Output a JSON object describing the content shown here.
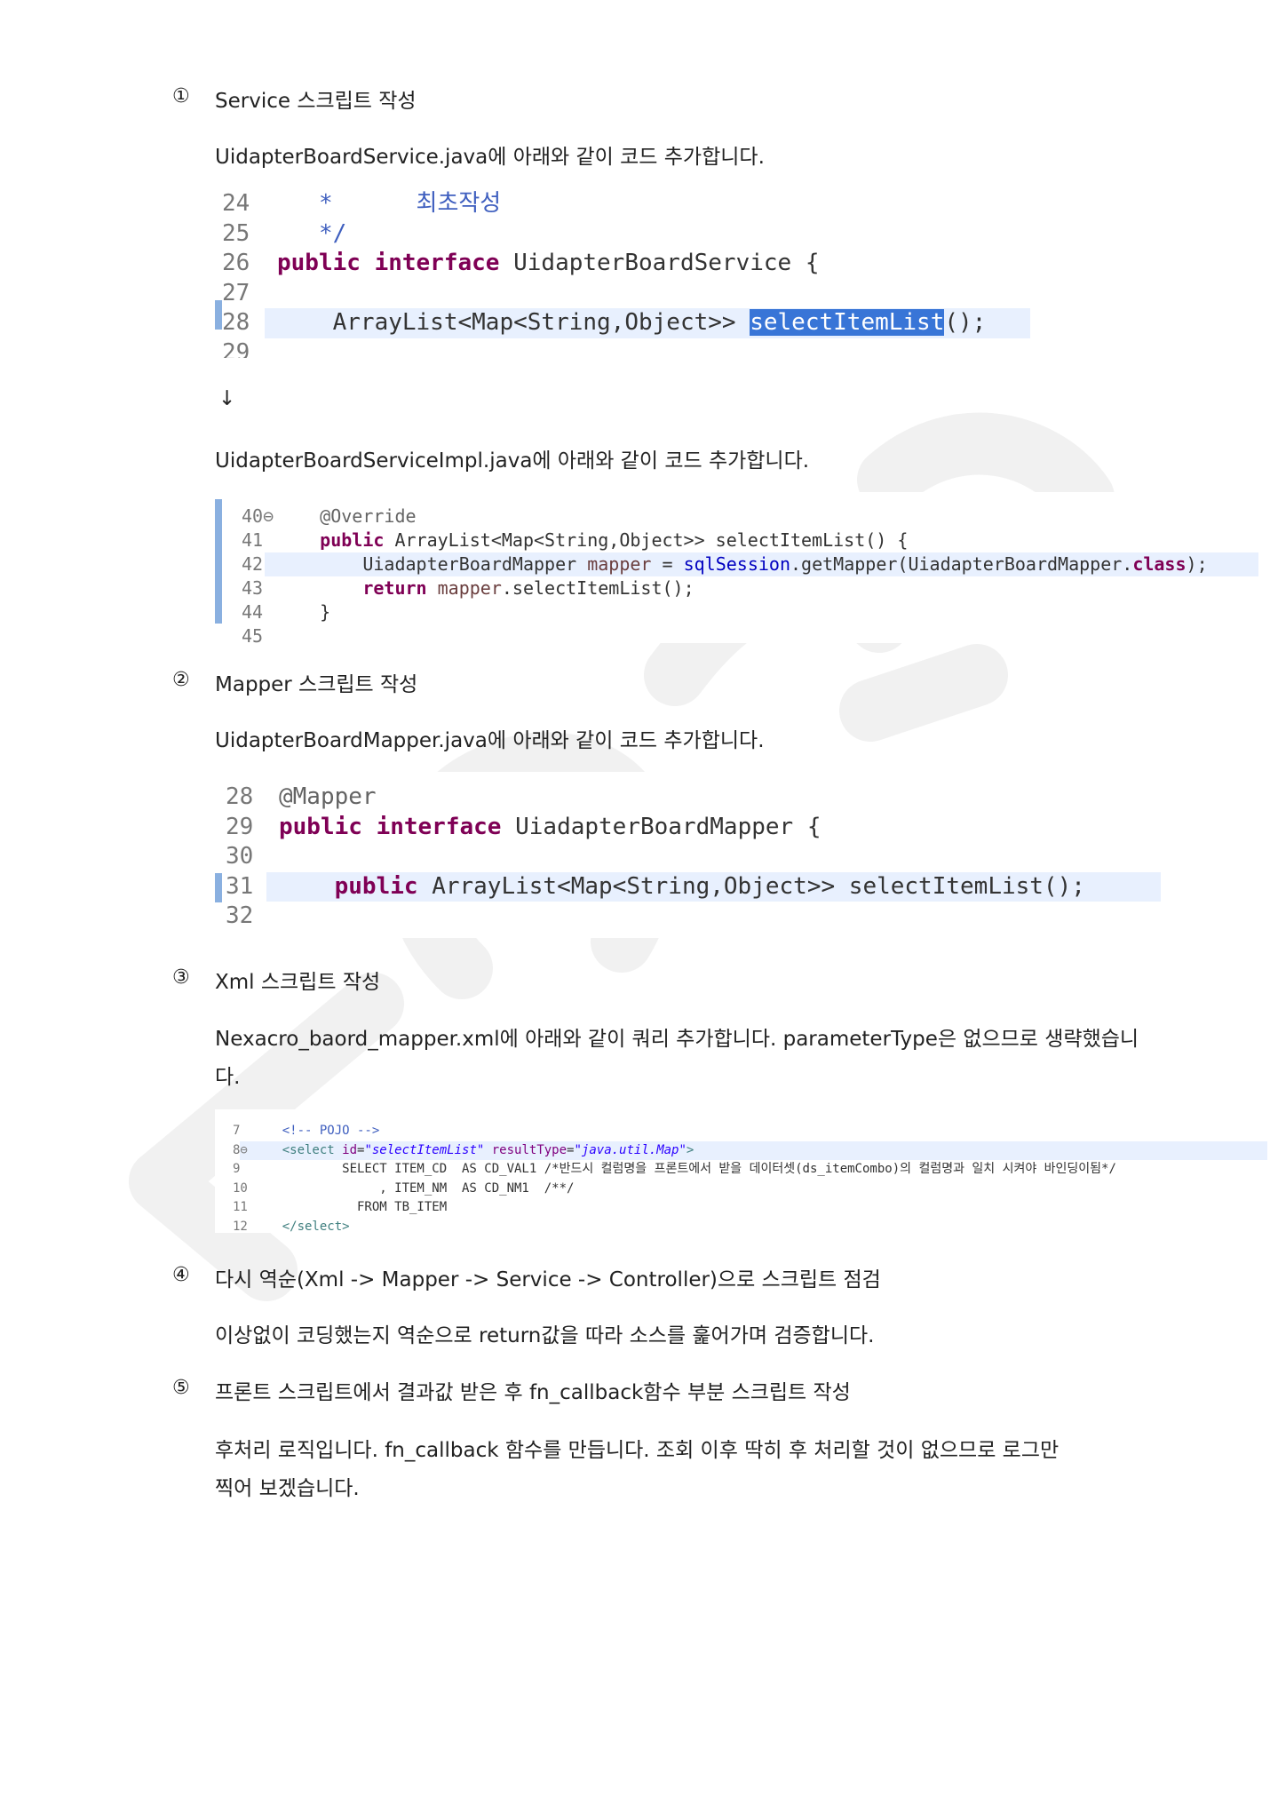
{
  "sections": [
    {
      "marker": "①",
      "heading": "Service  스크립트 작성"
    },
    {
      "marker": "②",
      "heading": "Mapper 스크립트 작성"
    },
    {
      "marker": "③",
      "heading": "Xml 스크립트 작성"
    },
    {
      "marker": "④",
      "heading": "다시 역순(Xml -> Mapper -> Service -> Controller)으로 스크립트 점검"
    },
    {
      "marker": "⑤",
      "heading": "프론트 스크립트에서 결과값 받은 후 fn_callback함수 부분 스크립트 작성"
    }
  ],
  "paragraphs": {
    "service_intro": "UidapterBoardService.java에 아래와 같이 코드 추가합니다.",
    "arrow": "↓",
    "impl_intro": "UidapterBoardServiceImpl.java에 아래와 같이 코드 추가합니다.",
    "mapper_intro": "UidapterBoardMapper.java에 아래와 같이 코드 추가합니다.",
    "xml_intro_1": "Nexacro_baord_mapper.xml에 아래와 같이 쿼리 추가합니다. parameterType은 없으므로 생략했습니",
    "xml_intro_2": "다.",
    "check": "이상없이 코딩했는지 역순으로 return값을 따라 소스를 훑어가며 검증합니다.",
    "callback_1": "후처리 로직입니다. fn_callback 함수를 만듭니다. 조회 이후 딱히 후 처리할 것이 없으므로 로그만",
    "callback_2": "찍어 보겠습니다."
  },
  "code_blocks": [
    {
      "lines": [
        {
          "n": "24",
          "tokens": [
            {
              "t": "   *      최초작성",
              "c": "cm"
            }
          ]
        },
        {
          "n": "25",
          "tokens": [
            {
              "t": "   */",
              "c": "cm"
            }
          ]
        },
        {
          "n": "26",
          "tokens": [
            {
              "t": "public interface ",
              "c": "k"
            },
            {
              "t": "UidapterBoardService {",
              "c": "ty"
            }
          ]
        },
        {
          "n": "27",
          "tokens": []
        },
        {
          "n": "28",
          "hl": true,
          "tokens": [
            {
              "t": "    ArrayList<Map<String,Object>> ",
              "c": "ty"
            },
            {
              "t": "selectItemList",
              "c": "sel"
            },
            {
              "t": "();",
              "c": "ty"
            }
          ]
        },
        {
          "n": "29",
          "tokens": []
        }
      ]
    },
    {
      "lines": [
        {
          "n": "40⊖",
          "tokens": [
            {
              "t": "    @Override",
              "c": "ann"
            }
          ]
        },
        {
          "n": "41",
          "tokens": [
            {
              "t": "    public ",
              "c": "k"
            },
            {
              "t": "ArrayList<Map<String,Object>> selectItemList() {",
              "c": "ty"
            }
          ]
        },
        {
          "n": "42",
          "hl": true,
          "tokens": [
            {
              "t": "        UiadapterBoardMapper ",
              "c": "ty"
            },
            {
              "t": "mapper",
              "c": "var"
            },
            {
              "t": " = ",
              "c": "ty"
            },
            {
              "t": "sqlSession",
              "c": "fld"
            },
            {
              "t": ".getMapper(UiadapterBoardMapper.",
              "c": "ty"
            },
            {
              "t": "class",
              "c": "k"
            },
            {
              "t": ");",
              "c": "ty"
            }
          ]
        },
        {
          "n": "43",
          "tokens": [
            {
              "t": "        return ",
              "c": "k"
            },
            {
              "t": "mapper",
              "c": "var"
            },
            {
              "t": ".selectItemList();",
              "c": "ty"
            }
          ]
        },
        {
          "n": "44",
          "tokens": [
            {
              "t": "    }",
              "c": "ty"
            }
          ]
        },
        {
          "n": "45",
          "tokens": []
        }
      ]
    },
    {
      "lines": [
        {
          "n": "28",
          "tokens": [
            {
              "t": "@Mapper",
              "c": "ann"
            }
          ]
        },
        {
          "n": "29",
          "tokens": [
            {
              "t": "public interface ",
              "c": "k"
            },
            {
              "t": "UiadapterBoardMapper {",
              "c": "ty"
            }
          ]
        },
        {
          "n": "30",
          "tokens": []
        },
        {
          "n": "31",
          "hl": true,
          "tokens": [
            {
              "t": "    public ",
              "c": "k"
            },
            {
              "t": "ArrayList<Map<String,Object>> selectItemList();",
              "c": "ty"
            }
          ]
        },
        {
          "n": "32",
          "tokens": []
        }
      ]
    },
    {
      "lines": [
        {
          "n": "7",
          "tokens": [
            {
              "t": "    <!-- POJO -->",
              "c": "cm"
            }
          ]
        },
        {
          "n": "8⊖",
          "hl": true,
          "tokens": [
            {
              "t": "    <select ",
              "c": "tag"
            },
            {
              "t": "id",
              "c": "attr"
            },
            {
              "t": "=",
              "c": "ty"
            },
            {
              "t": "\"selectItemList\" ",
              "c": "str"
            },
            {
              "t": "resultType",
              "c": "attr"
            },
            {
              "t": "=",
              "c": "ty"
            },
            {
              "t": "\"java.util.Map\"",
              "c": "str"
            },
            {
              "t": ">",
              "c": "tag"
            }
          ]
        },
        {
          "n": "9",
          "tokens": [
            {
              "t": "            SELECT ITEM_CD  AS CD_VAL1 /*반드시 컬럼명을 프론트에서 받을 데이터셋(ds_itemCombo)의 컬럼명과 일치 시켜야 바인딩이됨*/",
              "c": "ty"
            }
          ]
        },
        {
          "n": "10",
          "tokens": [
            {
              "t": "                 , ITEM_NM  AS CD_NM1  /**/",
              "c": "ty"
            }
          ]
        },
        {
          "n": "11",
          "tokens": [
            {
              "t": "              FROM TB_ITEM",
              "c": "ty"
            }
          ]
        },
        {
          "n": "12",
          "tokens": [
            {
              "t": "    </select>",
              "c": "tag"
            }
          ]
        }
      ]
    }
  ],
  "colors": {
    "keyword": "#7f0055",
    "selection": "#3875d7",
    "highlight_line": "#e8f0fe",
    "field": "#0000c0"
  }
}
